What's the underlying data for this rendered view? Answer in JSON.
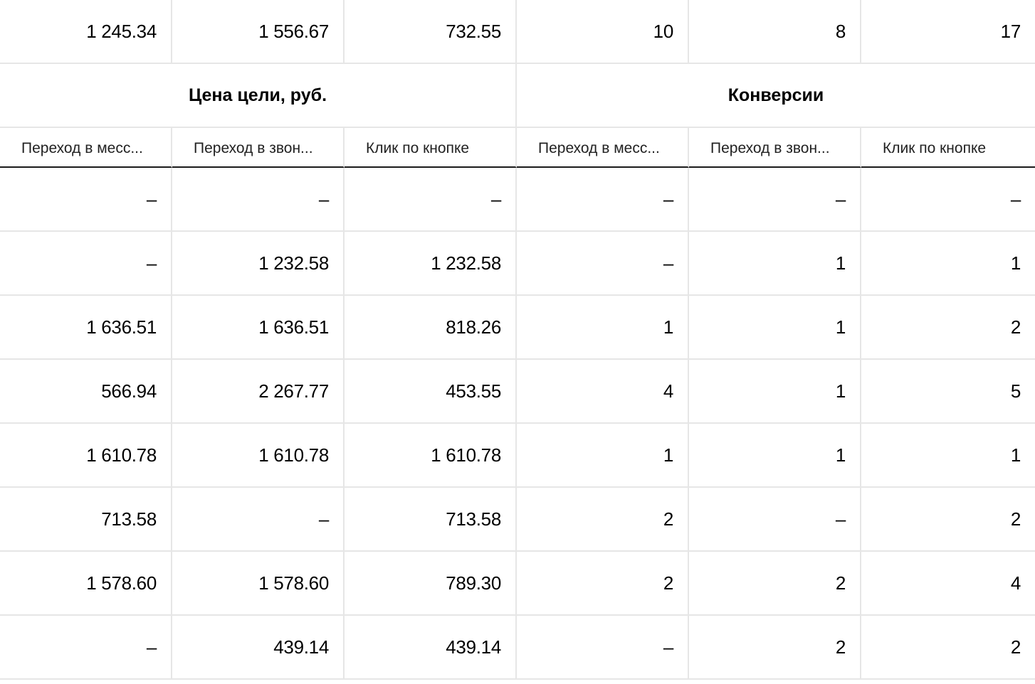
{
  "totals_row": [
    "1 245.34",
    "1 556.67",
    "732.55",
    "10",
    "8",
    "17"
  ],
  "groups": [
    {
      "label": "Цена цели, руб."
    },
    {
      "label": "Конверсии"
    }
  ],
  "subheaders": [
    "Переход в месс...",
    "Переход в звон...",
    "Клик по кнопке",
    "Переход в месс...",
    "Переход в звон...",
    "Клик по кнопке"
  ],
  "rows": [
    [
      "–",
      "–",
      "–",
      "–",
      "–",
      "–"
    ],
    [
      "–",
      "1 232.58",
      "1 232.58",
      "–",
      "1",
      "1"
    ],
    [
      "1 636.51",
      "1 636.51",
      "818.26",
      "1",
      "1",
      "2"
    ],
    [
      "566.94",
      "2 267.77",
      "453.55",
      "4",
      "1",
      "5"
    ],
    [
      "1 610.78",
      "1 610.78",
      "1 610.78",
      "1",
      "1",
      "1"
    ],
    [
      "713.58",
      "–",
      "713.58",
      "2",
      "–",
      "2"
    ],
    [
      "1 578.60",
      "1 578.60",
      "789.30",
      "2",
      "2",
      "4"
    ],
    [
      "–",
      "439.14",
      "439.14",
      "–",
      "2",
      "2"
    ]
  ],
  "colors": {
    "grid_line": "#e6e6e6",
    "header_underline": "#1a1a1a",
    "text": "#000000"
  }
}
